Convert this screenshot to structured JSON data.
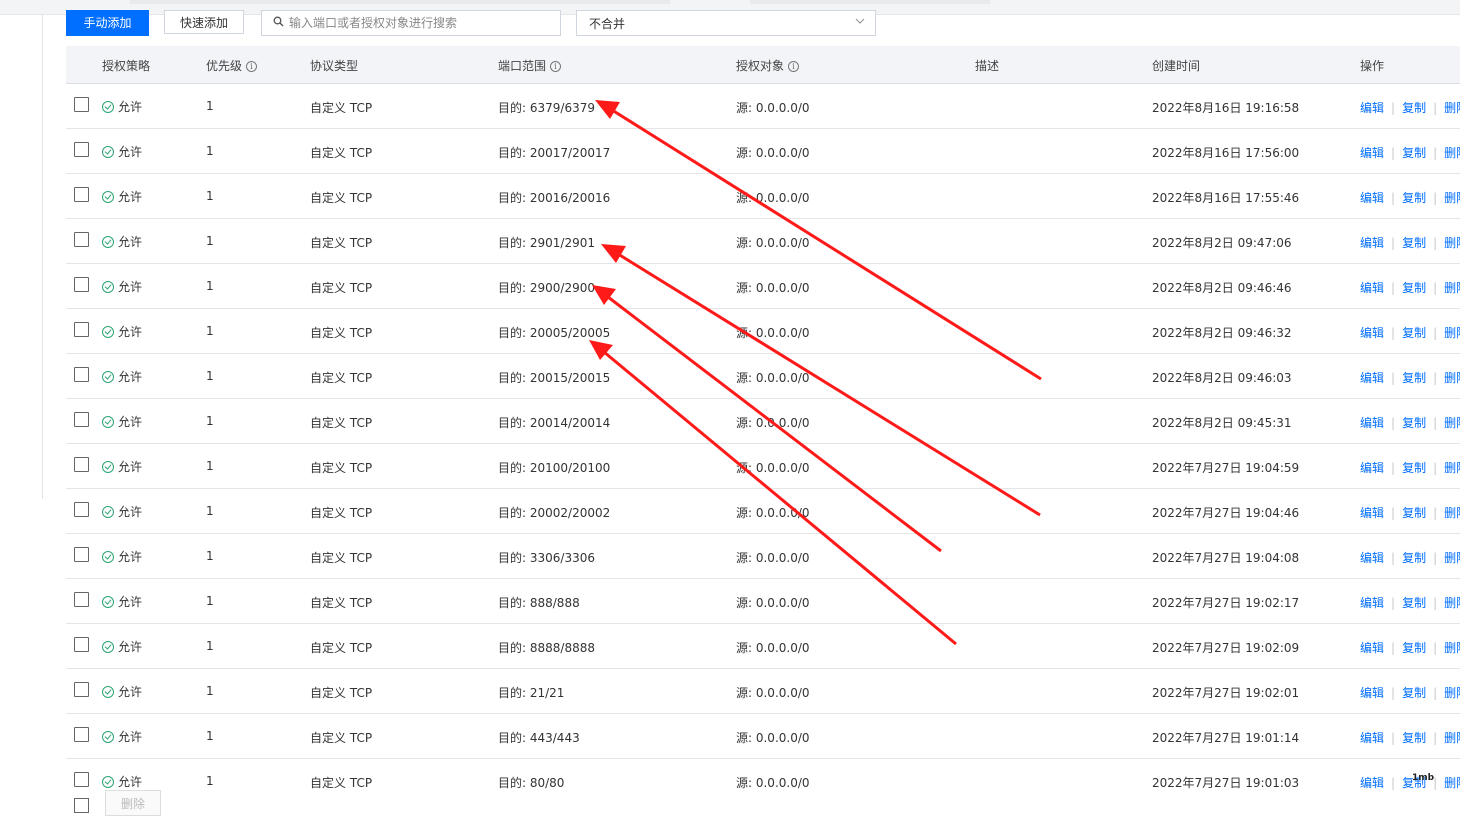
{
  "toolbar": {
    "manual_add": "手动添加",
    "quick_add": "快速添加",
    "search_placeholder": "输入端口或者授权对象进行搜索",
    "merge_select": "不合并"
  },
  "table": {
    "headers": {
      "policy": "授权策略",
      "priority": "优先级",
      "protocol": "协议类型",
      "port_range": "端口范围",
      "auth_object": "授权对象",
      "description": "描述",
      "created": "创建时间",
      "actions": "操作"
    },
    "action_labels": {
      "edit": "编辑",
      "copy": "复制",
      "delete": "删除"
    },
    "rows": [
      {
        "policy": "允许",
        "priority": "1",
        "protocol": "自定义 TCP",
        "port": "目的: 6379/6379",
        "auth": "源: 0.0.0.0/0",
        "created": "2022年8月16日 19:16:58"
      },
      {
        "policy": "允许",
        "priority": "1",
        "protocol": "自定义 TCP",
        "port": "目的: 20017/20017",
        "auth": "源: 0.0.0.0/0",
        "created": "2022年8月16日 17:56:00"
      },
      {
        "policy": "允许",
        "priority": "1",
        "protocol": "自定义 TCP",
        "port": "目的: 20016/20016",
        "auth": "源: 0.0.0.0/0",
        "created": "2022年8月16日 17:55:46"
      },
      {
        "policy": "允许",
        "priority": "1",
        "protocol": "自定义 TCP",
        "port": "目的: 2901/2901",
        "auth": "源: 0.0.0.0/0",
        "created": "2022年8月2日 09:47:06"
      },
      {
        "policy": "允许",
        "priority": "1",
        "protocol": "自定义 TCP",
        "port": "目的: 2900/2900",
        "auth": "源: 0.0.0.0/0",
        "created": "2022年8月2日 09:46:46"
      },
      {
        "policy": "允许",
        "priority": "1",
        "protocol": "自定义 TCP",
        "port": "目的: 20005/20005",
        "auth": "源: 0.0.0.0/0",
        "created": "2022年8月2日 09:46:32"
      },
      {
        "policy": "允许",
        "priority": "1",
        "protocol": "自定义 TCP",
        "port": "目的: 20015/20015",
        "auth": "源: 0.0.0.0/0",
        "created": "2022年8月2日 09:46:03"
      },
      {
        "policy": "允许",
        "priority": "1",
        "protocol": "自定义 TCP",
        "port": "目的: 20014/20014",
        "auth": "源: 0.0.0.0/0",
        "created": "2022年8月2日 09:45:31"
      },
      {
        "policy": "允许",
        "priority": "1",
        "protocol": "自定义 TCP",
        "port": "目的: 20100/20100",
        "auth": "源: 0.0.0.0/0",
        "created": "2022年7月27日 19:04:59"
      },
      {
        "policy": "允许",
        "priority": "1",
        "protocol": "自定义 TCP",
        "port": "目的: 20002/20002",
        "auth": "源: 0.0.0.0/0",
        "created": "2022年7月27日 19:04:46"
      },
      {
        "policy": "允许",
        "priority": "1",
        "protocol": "自定义 TCP",
        "port": "目的: 3306/3306",
        "auth": "源: 0.0.0.0/0",
        "created": "2022年7月27日 19:04:08"
      },
      {
        "policy": "允许",
        "priority": "1",
        "protocol": "自定义 TCP",
        "port": "目的: 888/888",
        "auth": "源: 0.0.0.0/0",
        "created": "2022年7月27日 19:02:17"
      },
      {
        "policy": "允许",
        "priority": "1",
        "protocol": "自定义 TCP",
        "port": "目的: 8888/8888",
        "auth": "源: 0.0.0.0/0",
        "created": "2022年7月27日 19:02:09"
      },
      {
        "policy": "允许",
        "priority": "1",
        "protocol": "自定义 TCP",
        "port": "目的: 21/21",
        "auth": "源: 0.0.0.0/0",
        "created": "2022年7月27日 19:02:01"
      },
      {
        "policy": "允许",
        "priority": "1",
        "protocol": "自定义 TCP",
        "port": "目的: 443/443",
        "auth": "源: 0.0.0.0/0",
        "created": "2022年7月27日 19:01:14"
      },
      {
        "policy": "允许",
        "priority": "1",
        "protocol": "自定义 TCP",
        "port": "目的: 80/80",
        "auth": "源: 0.0.0.0/0",
        "created": "2022年7月27日 19:01:03"
      }
    ]
  },
  "footer": {
    "delete_button": "删除"
  },
  "watermark": "1mb",
  "colors": {
    "primary": "#006eff",
    "success": "#2ba471",
    "annotation_arrow": "#ff1a1a"
  }
}
